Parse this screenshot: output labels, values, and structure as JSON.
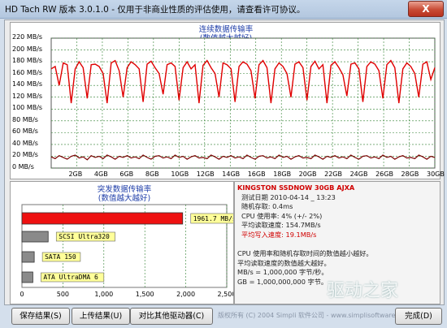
{
  "window": {
    "title": "HD Tach RW 版本 3.0.1.0 - 仅用于非商业性质的评估使用，请查看许可协议。",
    "close_label": "X"
  },
  "sequential": {
    "title_line1": "连续数据传输率",
    "title_line2": "(数值越大越好)"
  },
  "burst": {
    "title_line1": "突发数据传输率",
    "title_line2": "(数值越大越好)"
  },
  "info": {
    "drive": "KINGSTON SSDNOW 30GB AJXA",
    "date": "测试日期 2010-04-14 _ 13:23",
    "random_access": "随机存取: 0.4ms",
    "cpu": "CPU 使用率: 4% (+/- 2%)",
    "avg_read": "平均读取速度: 154.7MB/s",
    "avg_write": "平均写入速度: 19.1MB/s",
    "note1": "CPU 使用率和随机存取时间的数值越小越好。",
    "note2": "平均读取速度的数值越大越好。",
    "note3": "MB/s = 1,000,000 字节/秒。",
    "note4": "GB = 1,000,000,000 字节。"
  },
  "buttons": {
    "save": "保存结果(S)",
    "upload": "上传结果(U)",
    "compare": "对比其他驱动器(C)",
    "done": "完成(D)"
  },
  "copyright": "版权所有 (C) 2004 Simpli 软件公司 - www.simplisoftware.com",
  "watermark": "驱动之家",
  "colors": {
    "read_line": "#e00000",
    "write_line": "#7a0000",
    "burst_bar": "#ee1111",
    "other_bar": "#8a8a8a",
    "label_bg": "#ffff99",
    "grid": "#2f7f2f"
  },
  "chart_data": [
    {
      "type": "line",
      "title": "连续数据传输率 (数值越大越好)",
      "ylabel": "MB/s",
      "ylim": [
        0,
        220
      ],
      "yticks": [
        "0 MB/s",
        "20 MB/s",
        "40 MB/s",
        "60 MB/s",
        "80 MB/s",
        "100 MB/s",
        "120 MB/s",
        "140 MB/s",
        "160 MB/s",
        "180 MB/s",
        "200 MB/s",
        "220 MB/s"
      ],
      "xticks": [
        "2GB",
        "4GB",
        "6GB",
        "8GB",
        "10GB",
        "12GB",
        "14GB",
        "16GB",
        "18GB",
        "20GB",
        "22GB",
        "24GB",
        "26GB",
        "28GB",
        "30GB"
      ],
      "xlim": [
        0,
        30
      ],
      "series": [
        {
          "color": "#e00000",
          "values": [
            168,
            172,
            140,
            178,
            175,
            110,
            168,
            180,
            170,
            118,
            175,
            176,
            172,
            160,
            110,
            178,
            182,
            165,
            120,
            170,
            180,
            175,
            168,
            112,
            176,
            181,
            170,
            160,
            125,
            175,
            178,
            172,
            115,
            170,
            180,
            168,
            175,
            110,
            174,
            182,
            170,
            160,
            120,
            178,
            175,
            168,
            112,
            172,
            180,
            176,
            165,
            118,
            175,
            182,
            170,
            110,
            168,
            178,
            172,
            160,
            120,
            176,
            180,
            170,
            115,
            172,
            181,
            168,
            175,
            110,
            174,
            180,
            170,
            158,
            122,
            176,
            178,
            168,
            112,
            172,
            180,
            176,
            165,
            118,
            175,
            182,
            170,
            110,
            168,
            178,
            172,
            160,
            120,
            176,
            180,
            150,
            170
          ]
        },
        {
          "color": "#7a0000",
          "values": [
            19,
            16,
            21,
            18,
            15,
            20,
            22,
            17,
            19,
            14,
            21,
            18,
            20,
            16,
            22,
            19,
            15,
            20,
            18,
            21,
            17,
            19,
            16,
            22,
            18,
            15,
            20,
            21,
            17,
            19,
            16,
            22,
            18,
            20,
            15,
            19,
            21,
            17,
            18,
            16,
            22,
            19,
            15,
            20,
            18,
            21,
            17,
            19,
            16,
            22,
            18,
            15,
            20,
            21,
            17,
            19,
            16,
            22,
            18,
            20,
            15,
            19,
            21,
            17,
            18,
            16,
            22,
            19,
            15,
            20,
            18,
            21,
            17,
            19,
            16,
            22,
            18,
            15,
            20,
            21,
            17,
            19,
            16,
            22,
            18,
            20,
            15,
            19,
            21,
            17,
            18,
            16,
            22,
            19,
            15,
            20,
            18
          ]
        }
      ]
    },
    {
      "type": "bar",
      "title": "突发数据传输率 (数值越大越好)",
      "orientation": "horizontal",
      "xlim": [
        0,
        2500
      ],
      "xticks": [
        "0",
        "500",
        "1,000",
        "1,500",
        "2,000",
        "2,500"
      ],
      "categories": [
        "burst",
        "SCSI Ultra320",
        "SATA 150",
        "ATA UltraDMA 6"
      ],
      "values": [
        1961.7,
        320,
        150,
        133
      ],
      "labels": [
        "1961.7 MB/s",
        "SCSI Ultra320",
        "SATA 150",
        "ATA UltraDMA 6"
      ]
    }
  ]
}
